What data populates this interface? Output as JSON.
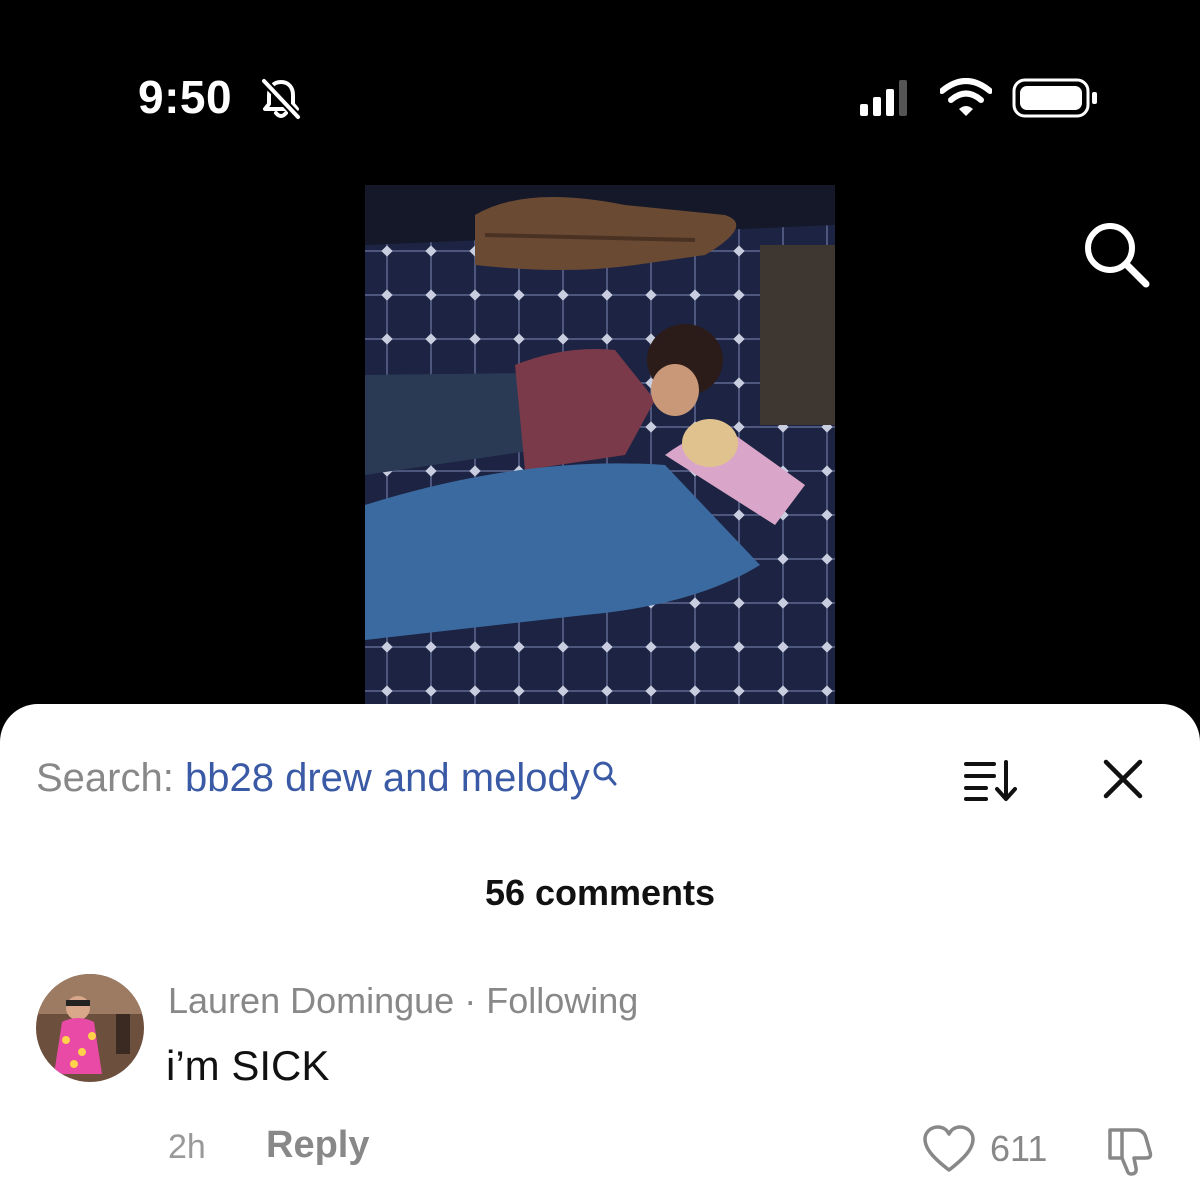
{
  "status_bar": {
    "time": "9:50"
  },
  "search": {
    "prefix": "Search:",
    "query": "bb28 drew and melody"
  },
  "comments": {
    "count_label": "56 comments",
    "items": [
      {
        "author": "Lauren Domingue",
        "separator": " · ",
        "relationship": "Following",
        "text": "i’m SICK",
        "time_ago": "2h",
        "reply_label": "Reply",
        "likes": "611"
      }
    ]
  },
  "colors": {
    "search_query": "#3b5aa6",
    "muted_text": "#888888",
    "background": "#000000",
    "sheet": "#ffffff"
  },
  "icons": [
    "bell-slash-icon",
    "signal-icon",
    "wifi-icon",
    "battery-icon",
    "search-icon",
    "sort-icon",
    "close-icon",
    "heart-icon",
    "dislike-icon"
  ]
}
